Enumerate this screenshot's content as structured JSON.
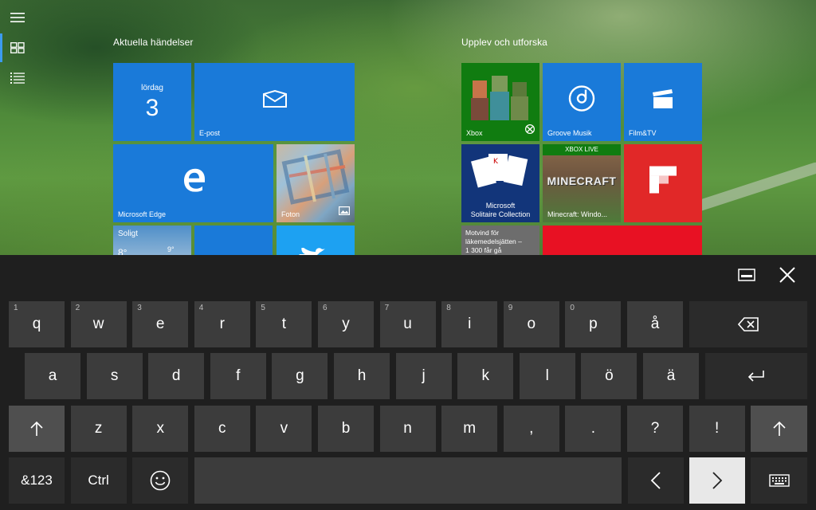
{
  "start": {
    "groups": [
      {
        "title": "Aktuella händelser"
      },
      {
        "title": "Upplev och utforska"
      }
    ],
    "tiles": {
      "calendar": {
        "day_name": "lördag",
        "day_number": "3"
      },
      "mail": {
        "label": "E-post"
      },
      "edge": {
        "label": "Microsoft Edge"
      },
      "photos": {
        "label": "Foton"
      },
      "weather": {
        "condition": "Soligt",
        "temp": "8°",
        "temp_small": "9°"
      },
      "xbox": {
        "label": "Xbox"
      },
      "groove": {
        "label": "Groove Musik"
      },
      "film": {
        "label": "Film&TV"
      },
      "solitaire": {
        "label_line1": "Microsoft",
        "label_line2": "Solitaire Collection"
      },
      "minecraft": {
        "badge": "XBOX LIVE",
        "logo": "MINECRAFT",
        "label": "Minecraft: Windo..."
      },
      "flipboard": {
        "label": ""
      },
      "news": {
        "line1": "Motvind för",
        "line2": "läkemedelsjätten –",
        "line3": "1 300 får gå"
      }
    }
  },
  "keyboard": {
    "row1": [
      {
        "num": "1",
        "label": "q"
      },
      {
        "num": "2",
        "label": "w"
      },
      {
        "num": "3",
        "label": "e"
      },
      {
        "num": "4",
        "label": "r"
      },
      {
        "num": "5",
        "label": "t"
      },
      {
        "num": "6",
        "label": "y"
      },
      {
        "num": "7",
        "label": "u"
      },
      {
        "num": "8",
        "label": "i"
      },
      {
        "num": "9",
        "label": "o"
      },
      {
        "num": "0",
        "label": "p"
      },
      {
        "num": "",
        "label": "å"
      }
    ],
    "row2": [
      "a",
      "s",
      "d",
      "f",
      "g",
      "h",
      "j",
      "k",
      "l",
      "ö",
      "ä"
    ],
    "row3": [
      "z",
      "x",
      "c",
      "v",
      "b",
      "n",
      "m",
      ",",
      ".",
      "?",
      "!"
    ],
    "symbols_label": "&123",
    "ctrl_label": "Ctrl"
  }
}
